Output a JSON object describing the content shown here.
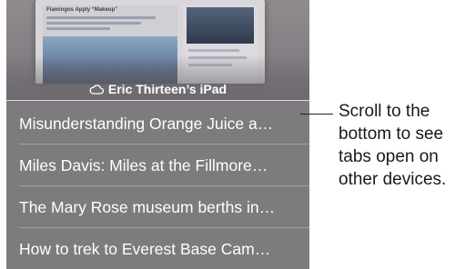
{
  "device": {
    "name": "Eric Thirteen’s iPad",
    "icon": "cloud-icon"
  },
  "thumbnail": {
    "headline": "Flamingos Apply “Makeup”"
  },
  "tabs": [
    {
      "title": "Misunderstanding Orange Juice a…"
    },
    {
      "title": "Miles Davis: Miles at the Fillmore…"
    },
    {
      "title": "The Mary Rose museum berths in…"
    },
    {
      "title": "How to trek to Everest Base Cam…"
    }
  ],
  "callout": {
    "lines": [
      "Scroll to the",
      "bottom to see",
      "tabs open on",
      "other devices."
    ]
  },
  "colors": {
    "panel": "#7d7b7d",
    "text": "#ffffff",
    "callout_text": "#1a1a1a"
  }
}
